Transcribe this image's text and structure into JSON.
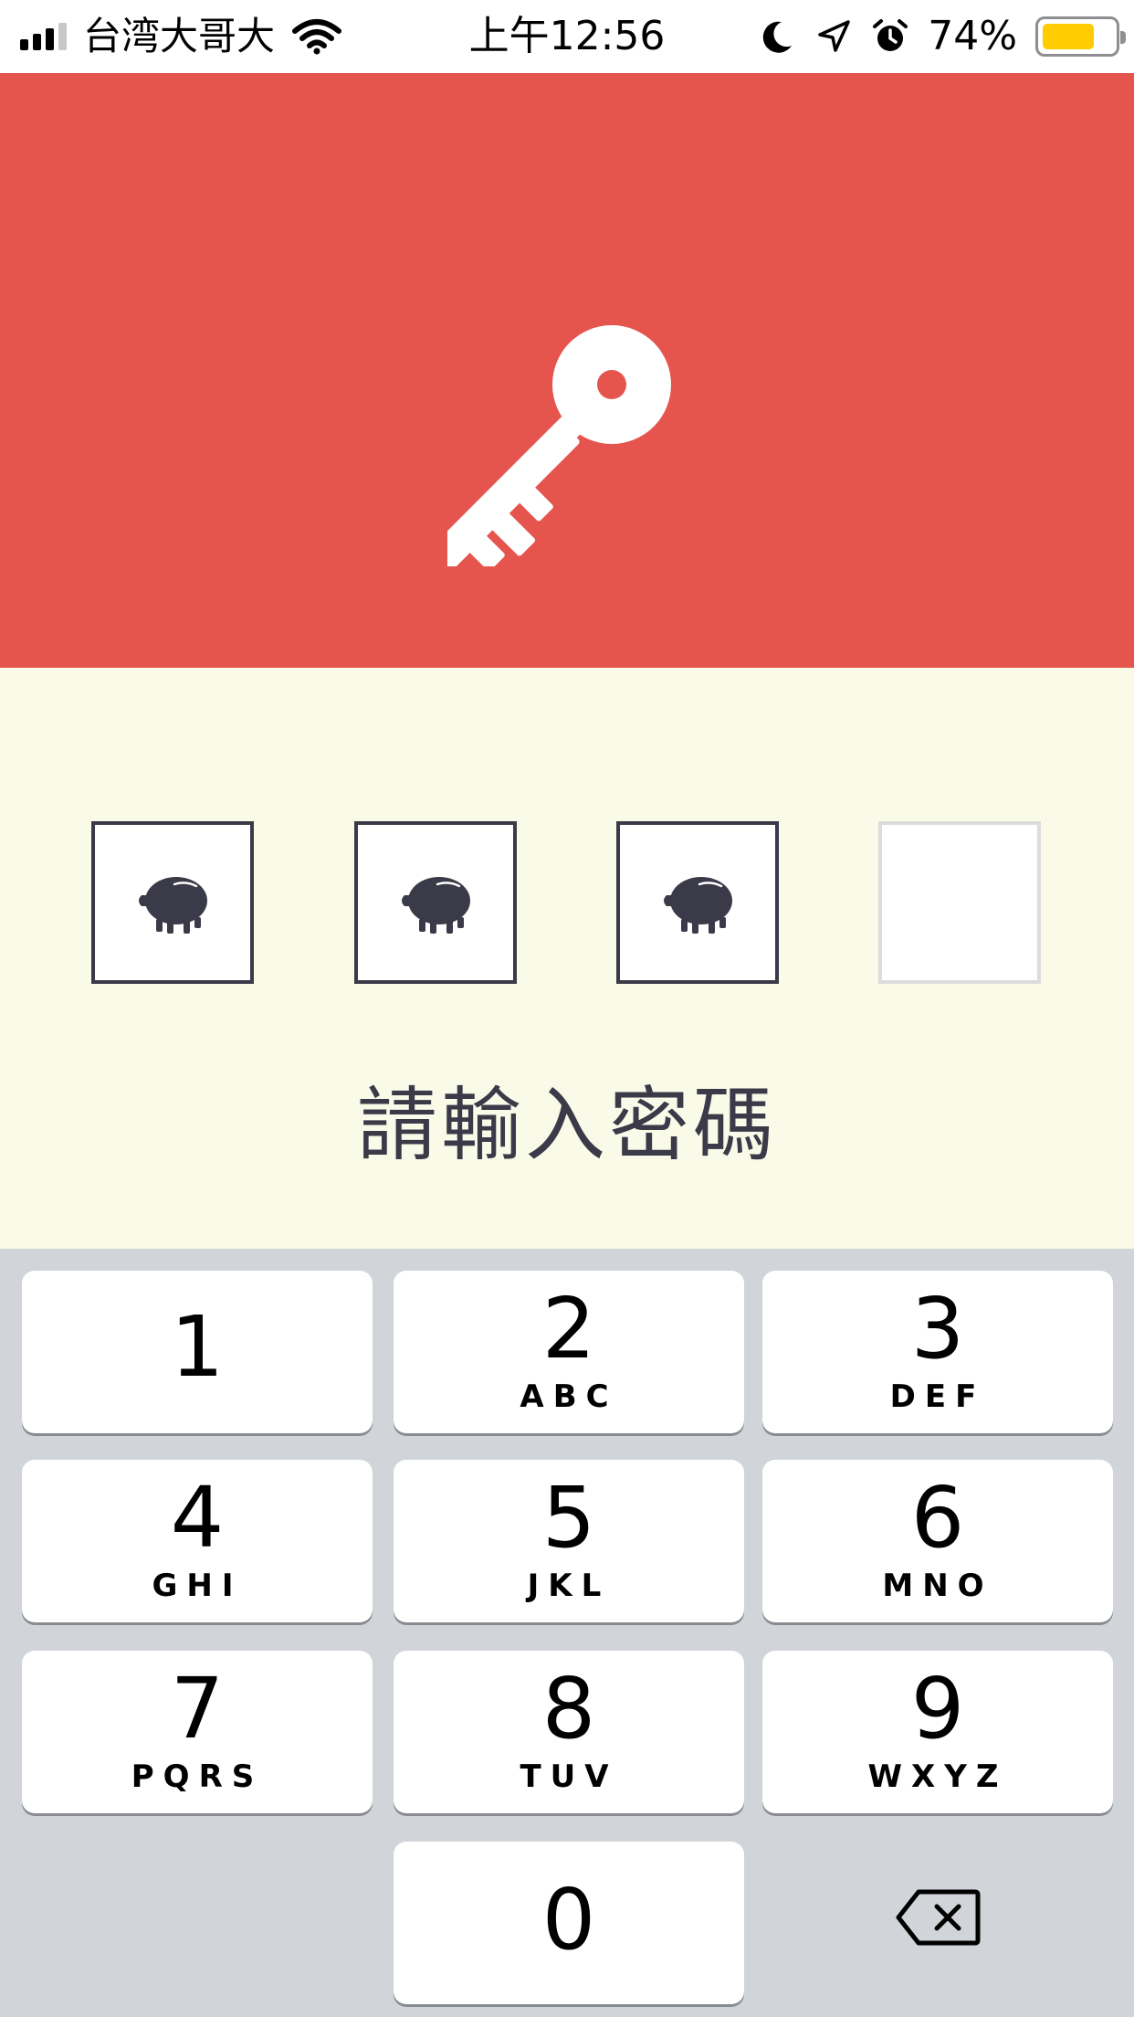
{
  "status_bar": {
    "carrier": "台湾大哥大",
    "time": "上午12:56",
    "battery_percent": "74%",
    "battery_level": 0.74,
    "icons": [
      "signal-icon",
      "wifi-icon",
      "moon-icon",
      "location-arrow-icon",
      "alarm-icon",
      "battery-icon"
    ]
  },
  "header": {
    "background": "#e5554e",
    "icon": "key-icon",
    "icon_color": "#ffffff"
  },
  "pin": {
    "background": "#f9fae8",
    "slots": [
      {
        "filled": true,
        "icon": "piggy-bank-icon"
      },
      {
        "filled": true,
        "icon": "piggy-bank-icon"
      },
      {
        "filled": true,
        "icon": "piggy-bank-icon"
      },
      {
        "filled": false
      }
    ],
    "prompt": "請輸入密碼"
  },
  "keypad": {
    "background": "#d1d4d9",
    "keys": [
      {
        "digit": "1",
        "letters": ""
      },
      {
        "digit": "2",
        "letters": "ABC"
      },
      {
        "digit": "3",
        "letters": "DEF"
      },
      {
        "digit": "4",
        "letters": "GHI"
      },
      {
        "digit": "5",
        "letters": "JKL"
      },
      {
        "digit": "6",
        "letters": "MNO"
      },
      {
        "digit": "7",
        "letters": "PQRS"
      },
      {
        "digit": "8",
        "letters": "TUV"
      },
      {
        "digit": "9",
        "letters": "WXYZ"
      },
      {
        "digit": "0",
        "letters": ""
      }
    ],
    "backspace_icon": "backspace-icon"
  }
}
